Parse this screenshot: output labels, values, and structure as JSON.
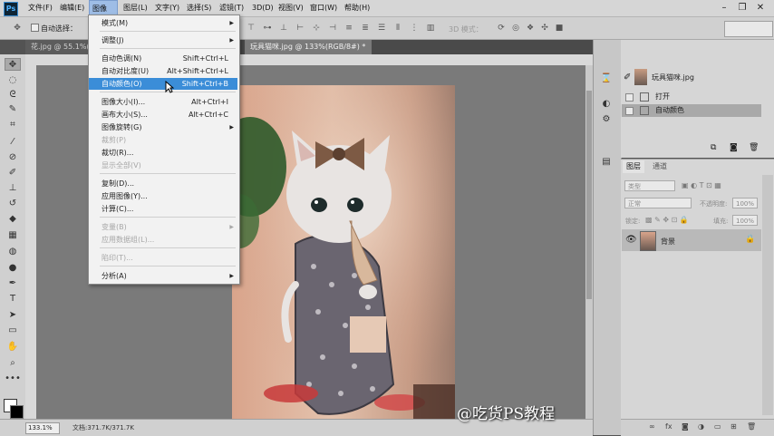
{
  "menubar": {
    "logo": "Ps",
    "items": [
      "文件(F)",
      "编辑(E)",
      "图像(I)",
      "图层(L)",
      "文字(Y)",
      "选择(S)",
      "滤镜(T)",
      "3D(D)",
      "视图(V)",
      "窗口(W)",
      "帮助(H)"
    ],
    "active_index": 2
  },
  "options": {
    "auto_select": "自动选择：",
    "mode_3d": "3D 模式："
  },
  "tabs": [
    {
      "label": "花.jpg @ 55.1%(R"
    },
    {
      "label": "玩具猫咪.jpg @ 133%(RGB/8#) *  ×"
    }
  ],
  "image_menu": {
    "items": [
      {
        "label": "模式(M)",
        "submenu": true
      },
      {
        "label": "调整(J)",
        "submenu": true
      },
      {
        "label": "自动色调(N)",
        "shortcut": "Shift+Ctrl+L"
      },
      {
        "label": "自动对比度(U)",
        "shortcut": "Alt+Shift+Ctrl+L"
      },
      {
        "label": "自动颜色(O)",
        "shortcut": "Shift+Ctrl+B",
        "highlighted": true
      },
      {
        "label": "图像大小(I)...",
        "shortcut": "Alt+Ctrl+I"
      },
      {
        "label": "画布大小(S)...",
        "shortcut": "Alt+Ctrl+C"
      },
      {
        "label": "图像旋转(G)",
        "submenu": true
      },
      {
        "label": "裁剪(P)",
        "disabled": true
      },
      {
        "label": "裁切(R)..."
      },
      {
        "label": "显示全部(V)",
        "disabled": true
      },
      {
        "label": "复制(D)..."
      },
      {
        "label": "应用图像(Y)..."
      },
      {
        "label": "计算(C)..."
      },
      {
        "label": "变量(B)",
        "submenu": true,
        "disabled": true
      },
      {
        "label": "应用数据组(L)...",
        "disabled": true
      },
      {
        "label": "陷印(T)...",
        "disabled": true
      },
      {
        "label": "分析(A)",
        "submenu": true
      }
    ]
  },
  "history": {
    "snapshot_name": "玩具猫咪.jpg",
    "steps": [
      "打开",
      "自动颜色"
    ],
    "active_step": 1
  },
  "layers": {
    "tabs": [
      "图层",
      "通道"
    ],
    "filter_kind": "类型",
    "blend_mode": "正常",
    "opacity_label": "不透明度:",
    "opacity_value": "100%",
    "lock_label": "锁定:",
    "fill_label": "填充:",
    "fill_value": "100%",
    "items": [
      {
        "name": "背景",
        "locked": true,
        "visible": true
      }
    ]
  },
  "status": {
    "zoom": "133.1%",
    "doc": "文档:371.7K/371.7K"
  },
  "watermark": "@吃货PS教程"
}
